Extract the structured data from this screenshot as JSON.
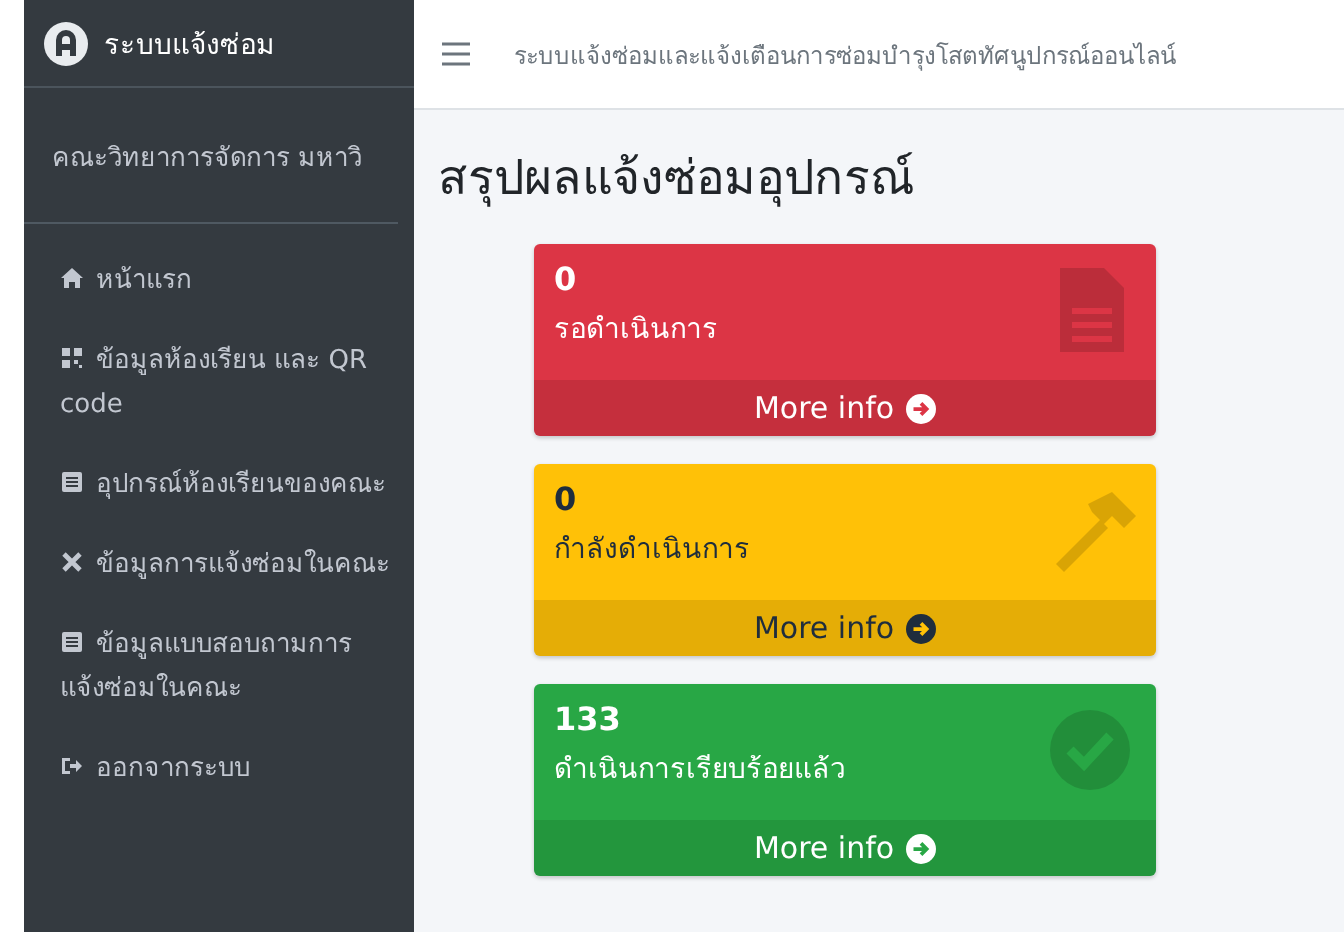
{
  "sidebar": {
    "brand": "ระบบแจ้งซ่อม",
    "user": "คณะวิทยาการจัดการ มหาวิ",
    "items": [
      {
        "kind": "home",
        "label": "หน้าแรก"
      },
      {
        "kind": "grid",
        "label": "ข้อมูลห้องเรียน และ QR code"
      },
      {
        "kind": "list",
        "label": "อุปกรณ์ห้องเรียนของคณะ"
      },
      {
        "kind": "tools",
        "label": "ข้อมูลการแจ้งซ่อมในคณะ"
      },
      {
        "kind": "list",
        "label": "ข้อมูลแบบสอบถามการแจ้งซ่อมในคณะ"
      },
      {
        "kind": "logout",
        "label": "ออกจากระบบ"
      }
    ]
  },
  "topbar": {
    "title": "ระบบแจ้งซ่อมและแจ้งเตือนการซ่อมบำรุงโสตทัศนูปกรณ์ออนไลน์"
  },
  "page_title": "สรุปผลแจ้งซ่อมอุปกรณ์",
  "cards": [
    {
      "kind": "document",
      "count": "0",
      "label": "รอดำเนินการ",
      "link": "More info",
      "color": "#dc3545"
    },
    {
      "kind": "hammer",
      "count": "0",
      "label": "กำลังดำเนินการ",
      "link": "More info",
      "color": "#ffc107"
    },
    {
      "kind": "check",
      "count": "133",
      "label": "ดำเนินการเรียบร้อยแล้ว",
      "link": "More info",
      "color": "#28a745"
    }
  ]
}
